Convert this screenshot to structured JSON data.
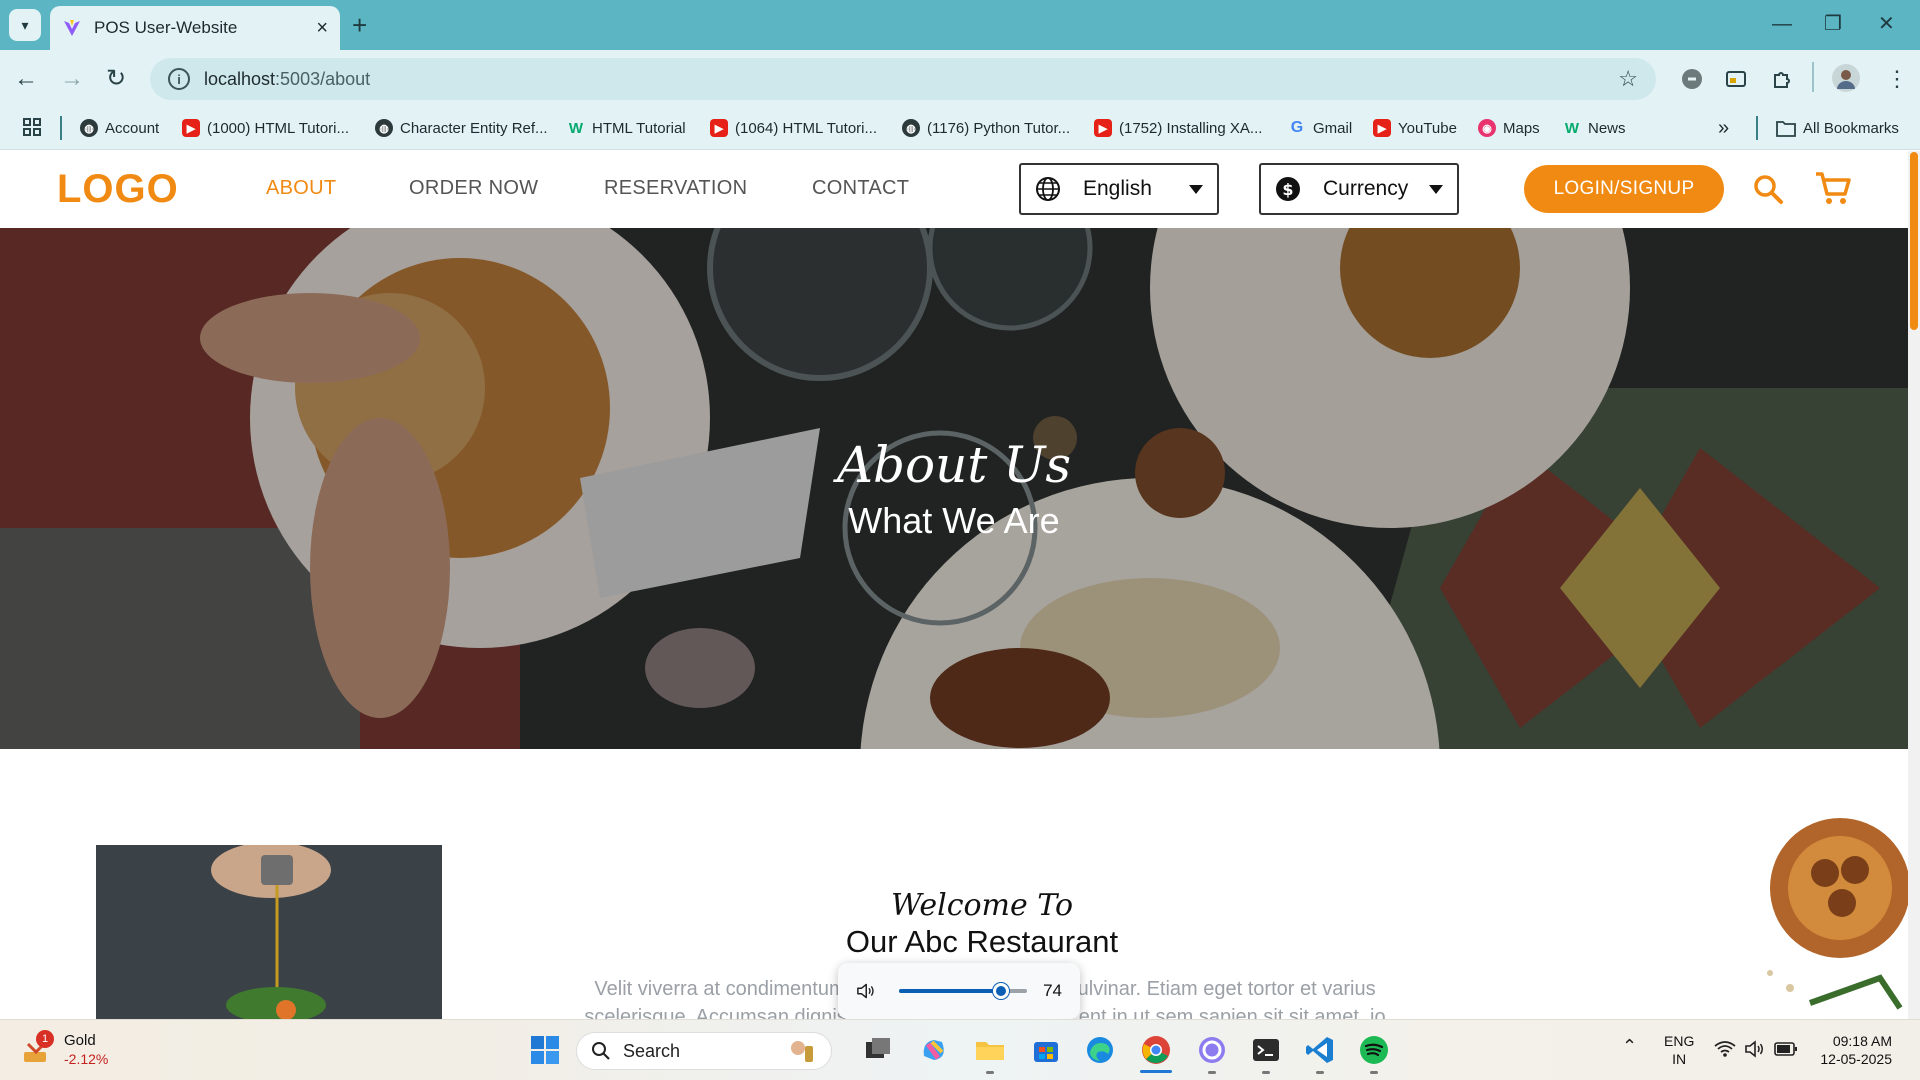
{
  "browser": {
    "tab_title": "POS User-Website",
    "new_tab": "+",
    "url_host": "localhost",
    "url_path": ":5003/about",
    "window_controls": {
      "minimize": "—",
      "restore": "❐",
      "close": "✕"
    }
  },
  "bookmarks": {
    "items": [
      {
        "label": "Account",
        "icon": "globe-icon"
      },
      {
        "label": "(1000) HTML Tutori...",
        "icon": "youtube-icon"
      },
      {
        "label": "Character Entity Ref...",
        "icon": "globe-icon"
      },
      {
        "label": "HTML Tutorial",
        "icon": "w3schools-icon"
      },
      {
        "label": "(1064) HTML Tutori...",
        "icon": "youtube-icon"
      },
      {
        "label": "(1176) Python Tutor...",
        "icon": "globe-icon"
      },
      {
        "label": "(1752) Installing XA...",
        "icon": "youtube-icon"
      },
      {
        "label": "Gmail",
        "icon": "google-icon"
      },
      {
        "label": "YouTube",
        "icon": "youtube-icon"
      },
      {
        "label": "Maps",
        "icon": "maps-icon"
      },
      {
        "label": "News",
        "icon": "w3schools-icon"
      }
    ],
    "more": "»",
    "all_bookmarks": "All Bookmarks"
  },
  "site": {
    "logo": "LOGO",
    "menu": [
      "ABOUT",
      "ORDER NOW",
      "RESERVATION",
      "CONTACT"
    ],
    "active_menu": "ABOUT",
    "language": "English",
    "currency": "Currency",
    "login_label": "LOGIN/SIGNUP"
  },
  "hero": {
    "script_title": "About Us",
    "subtitle": "What We Are"
  },
  "welcome": {
    "script": "Welcome To",
    "title": "Our Abc Restaurant",
    "body_line1_left": "Velit viverra at condimentum",
    "body_line1_right": "ulvinar. Etiam eget tortor et varius",
    "body_line2_left": "scelerisque. Accumsan dignis",
    "body_line2_right": "ent in ut sem sapien sit sit amet, io"
  },
  "volume": {
    "value": "74",
    "level": 0.74
  },
  "taskbar": {
    "widget_title": "Gold",
    "widget_value": "-2.12%",
    "widget_badge": "1",
    "search_label": "Search",
    "lang_line1": "ENG",
    "lang_line2": "IN",
    "time": "09:18 AM",
    "date": "12-05-2025"
  },
  "colors": {
    "accent": "#f08a12",
    "chrome_bar": "#5bb5c2",
    "chrome_light": "#e2f2f5"
  }
}
